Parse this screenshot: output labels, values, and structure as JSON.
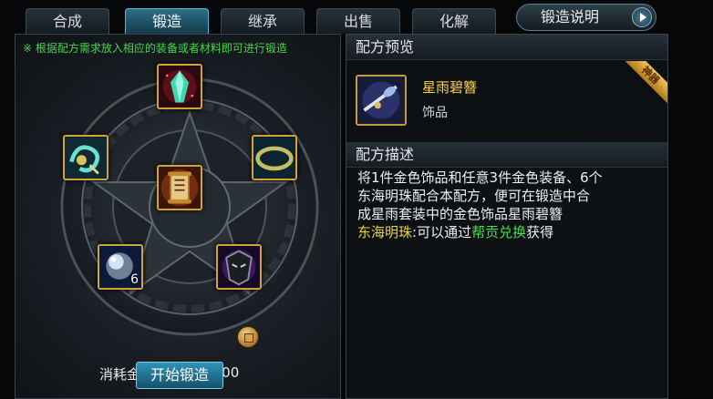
{
  "tabs": [
    {
      "label": "合成",
      "active": false
    },
    {
      "label": "锻造",
      "active": true
    },
    {
      "label": "继承",
      "active": false
    },
    {
      "label": "出售",
      "active": false
    },
    {
      "label": "化解",
      "active": false
    }
  ],
  "help_button": {
    "label": "锻造说明"
  },
  "left_panel": {
    "hint": "※ 根据配方需求放入相应的装备或者材料即可进行锻造",
    "slots": [
      {
        "icon": "red-gem-icon"
      },
      {
        "icon": "jade-pendant-icon"
      },
      {
        "icon": "gold-bracelet-icon"
      },
      {
        "icon": "scroll-recipe-icon"
      },
      {
        "icon": "pearl-icon",
        "quantity": "6"
      },
      {
        "icon": "dark-helmet-icon"
      }
    ],
    "cost_label": "消耗金币：",
    "cost_value": "180000",
    "start_button": "开始锻造"
  },
  "right_panel": {
    "preview_title": "配方预览",
    "item": {
      "name": "星雨碧簪",
      "type": "饰品",
      "badge": "神器"
    },
    "desc_title": "配方描述",
    "desc_lines": [
      "将1件金色饰品和任意3件金色装备、6个",
      "东海明珠配合本配方，便可在锻造中合",
      "成星雨套装中的金色饰品星雨碧簪"
    ],
    "note": {
      "term": "东海明珠",
      "sep": ":可以通过",
      "link": "帮贡兑换",
      "tail": "获得"
    }
  },
  "colors": {
    "accent": "#2b6f8a",
    "gold_border": "#d2a437",
    "hint_green": "#46d64a",
    "item_name": "#ffd24a"
  }
}
